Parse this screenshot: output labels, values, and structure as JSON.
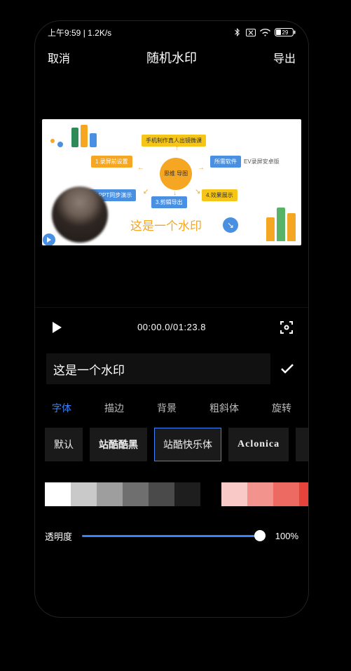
{
  "status": {
    "time_net": "上午9:59 | 1.2K/s",
    "battery": "29"
  },
  "nav": {
    "cancel": "取消",
    "title": "随机水印",
    "export": "导出"
  },
  "preview": {
    "watermark_text": "这是一个水印",
    "mm_center": "思维\n导图",
    "mm_top": "手机制作真人出镜微课",
    "mm_left1": "1.录屏前设置",
    "mm_left2": "2.PPT同步演示",
    "mm_right1": "所需软件",
    "mm_right2": "4.效果展示",
    "mm_bottom": "3.剪辑导出",
    "mm_rightlabel": "EV录屏安卓版"
  },
  "playback": {
    "time": "00:00.0/01:23.8"
  },
  "input": {
    "value": "这是一个水印"
  },
  "tabs": {
    "font": "字体",
    "stroke": "描边",
    "bg": "背景",
    "bold": "粗斜体",
    "rotate": "旋转"
  },
  "fonts": {
    "default": "默认",
    "zkkh": "站酷酷黑",
    "zkkl": "站酷快乐体",
    "aclonica": "Aclonica"
  },
  "opacity": {
    "label": "透明度",
    "value": "100%"
  }
}
